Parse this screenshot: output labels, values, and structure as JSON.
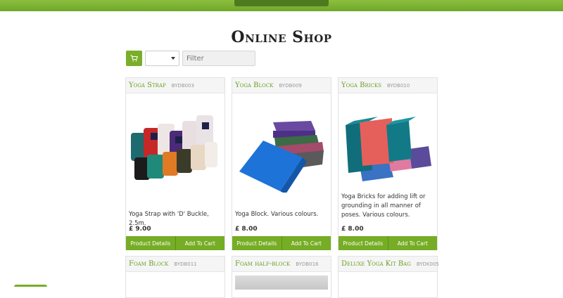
{
  "page": {
    "title": "Online Shop"
  },
  "toolbar": {
    "filter_placeholder": "Filter",
    "select_value": ""
  },
  "products": [
    {
      "name": "Yoga Strap",
      "code": "BYDB003",
      "desc": "Yoga Strap with 'D' Buckle, 2.5m.",
      "price": "£ 9.00",
      "details_label": "Product Details",
      "cart_label": "Add To Cart"
    },
    {
      "name": "Yoga Block",
      "code": "BYDB009",
      "desc": "Yoga Block. Various colours.",
      "price": "£ 8.00",
      "details_label": "Product Details",
      "cart_label": "Add To Cart"
    },
    {
      "name": "Yoga Bricks",
      "code": "BYDB010",
      "desc": "Yoga Bricks for adding lift or grounding in all manner of poses. Various colours.",
      "price": "£ 8.00",
      "details_label": "Product Details",
      "cart_label": "Add To Cart"
    },
    {
      "name": "Foam Block",
      "code": "BYDB011"
    },
    {
      "name": "Foam half-block",
      "code": "BYDB016"
    },
    {
      "name": "Deluxe Yoga Kit Bag",
      "code": "BYDK005"
    }
  ],
  "colors": {
    "accent": "#76ad25",
    "title_green": "#6a9e22"
  }
}
